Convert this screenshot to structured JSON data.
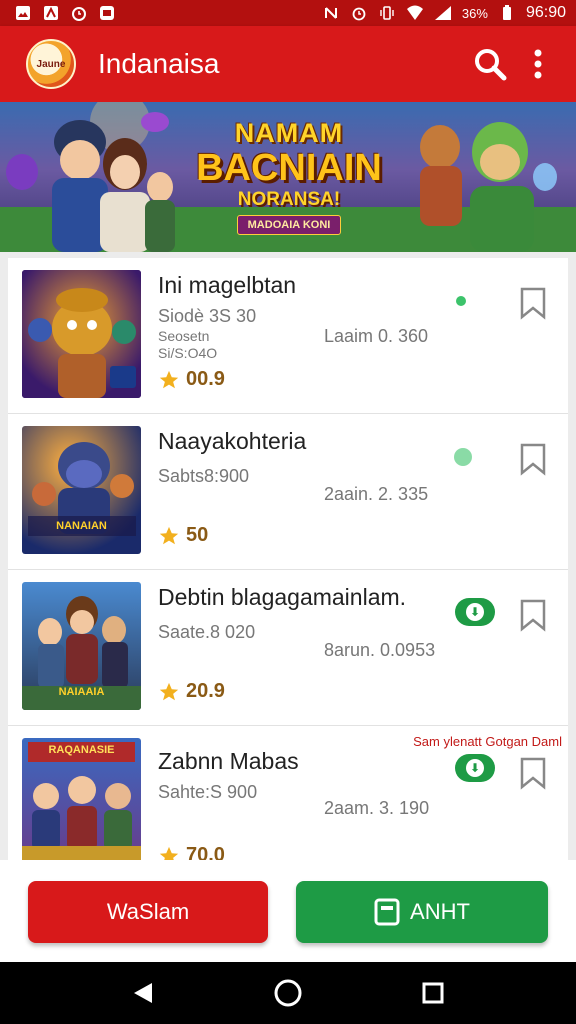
{
  "status_bar": {
    "time": "96:90",
    "battery": "36%"
  },
  "app_bar": {
    "logo_text": "Jaune",
    "title": "Indanaisa"
  },
  "banner": {
    "line1": "NAMAM",
    "line2": "BACNIAIN",
    "line3": "NORANSA!",
    "line4": "MADOAIA KONI"
  },
  "games": [
    {
      "name": "Ini magelbtan",
      "sub": "Siodè 3S 30",
      "sub2a": "Seosetn",
      "sub2b": "Si/S:O4O",
      "meta": "Laaim 0. 360",
      "rating": "00.9",
      "thumb_caption": ""
    },
    {
      "name": "Naayakohteria",
      "sub": "Sabts8:900",
      "sub2a": "",
      "sub2b": "",
      "meta": "2aain. 2. 335",
      "rating": "50",
      "thumb_caption": "NANAIAN"
    },
    {
      "name": "Debtin blagagamainlam.",
      "sub": "Saate.8 020",
      "sub2a": "",
      "sub2b": "",
      "meta": "8arun. 0.0953",
      "rating": "20.9",
      "thumb_caption": "NAIAAIA"
    },
    {
      "name": "Zabnn Mabas",
      "sub": "Sahte:S 900",
      "sub2a": "",
      "sub2b": "",
      "meta": "2aam. 3. 190",
      "rating": "70.0",
      "thumb_caption": "RAQANASIE",
      "promo": "Sam ylenatt Gotgan Daml"
    }
  ],
  "buttons": {
    "left": "WaSlam",
    "right": "ANHT"
  },
  "colors": {
    "primary_red": "#d8191a",
    "status_red": "#b3100f",
    "accent_green": "#1e9b45",
    "star_gold": "#f2b01e"
  }
}
